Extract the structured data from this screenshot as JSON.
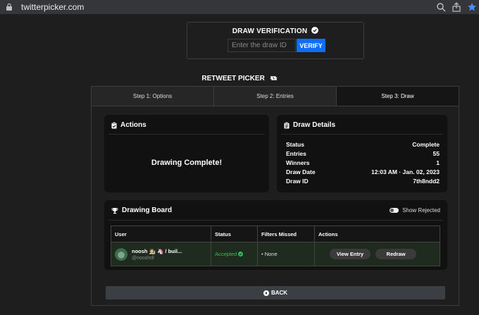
{
  "browser": {
    "url": "twitterpicker.com"
  },
  "verification": {
    "title": "DRAW VERIFICATION",
    "input_placeholder": "Enter the draw ID",
    "verify_label": "VERIFY"
  },
  "picker": {
    "title": "RETWEET PICKER",
    "steps": [
      "Step 1: Options",
      "Step 2: Entries",
      "Step 3: Draw"
    ]
  },
  "actions_card": {
    "title": "Actions",
    "message": "Drawing Complete!"
  },
  "details_card": {
    "title": "Draw Details",
    "rows": [
      {
        "label": "Status",
        "value": "Complete"
      },
      {
        "label": "Entries",
        "value": "55"
      },
      {
        "label": "Winners",
        "value": "1"
      },
      {
        "label": "Draw Date",
        "value": "12:03 AM · Jan. 02, 2023"
      },
      {
        "label": "Draw ID",
        "value": "7th8ndd2"
      }
    ]
  },
  "board": {
    "title": "Drawing Board",
    "toggle_label": "Show Rejected",
    "columns": [
      "User",
      "Status",
      "Filters Missed",
      "Actions"
    ],
    "rows": [
      {
        "user_name": "noosh 🧑‍🔬 🦄 / buil...",
        "user_handle": "@nooshdl",
        "status": "Accepted",
        "filters_missed": "• None",
        "view_label": "View Entry",
        "redraw_label": "Redraw"
      }
    ]
  },
  "back_label": "BACK",
  "colors": {
    "accent": "#0d6efd",
    "accepted": "#2ec05a",
    "background": "#1e1e1e",
    "card": "#111111"
  }
}
